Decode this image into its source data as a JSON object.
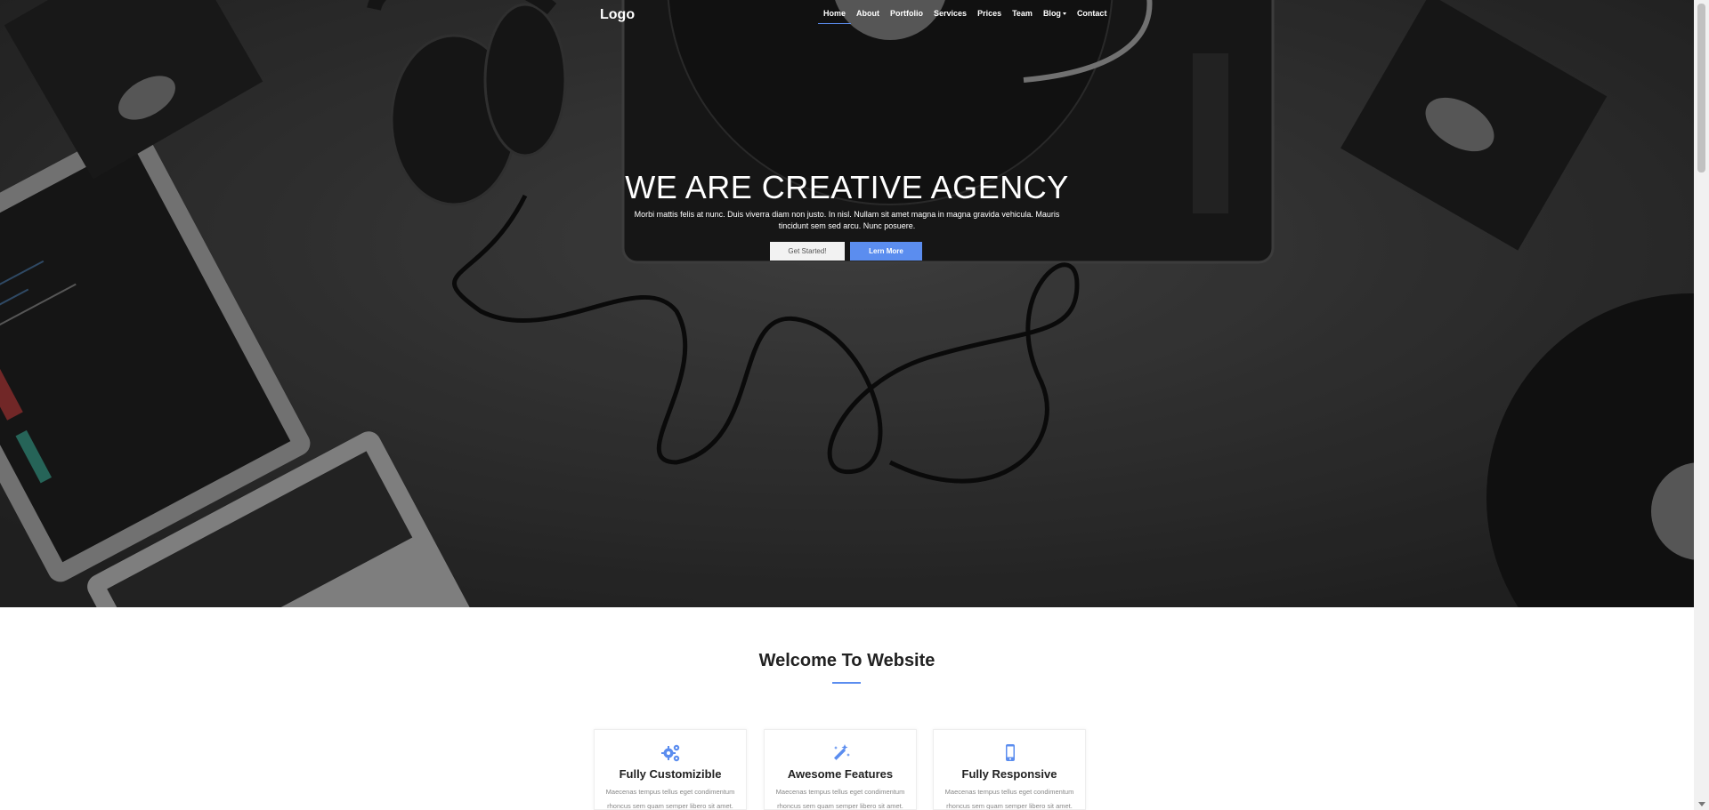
{
  "navbar": {
    "logo": "Logo",
    "items": [
      {
        "label": "Home",
        "active": true
      },
      {
        "label": "About"
      },
      {
        "label": "Portfolio"
      },
      {
        "label": "Services"
      },
      {
        "label": "Prices"
      },
      {
        "label": "Team"
      },
      {
        "label": "Blog",
        "dropdown": true
      },
      {
        "label": "Contact"
      }
    ]
  },
  "hero": {
    "title": "WE ARE CREATIVE AGENCY",
    "text": "Morbi mattis felis at nunc. Duis viverra diam non justo. In nisl. Nullam sit amet magna in magna gravida vehicula. Mauris tincidunt sem sed arcu. Nunc posuere.",
    "button_primary": "Get Started!",
    "button_secondary": "Lern More"
  },
  "welcome": {
    "title": "Welcome To Website"
  },
  "cards": [
    {
      "icon": "gears-icon",
      "title": "Fully Customizible",
      "text": "Maecenas tempus tellus eget condimentum rhoncus sem quam semper libero sit amet."
    },
    {
      "icon": "magic-wand-icon",
      "title": "Awesome Features",
      "text": "Maecenas tempus tellus eget condimentum rhoncus sem quam semper libero sit amet."
    },
    {
      "icon": "mobile-icon",
      "title": "Fully Responsive",
      "text": "Maecenas tempus tellus eget condimentum rhoncus sem quam semper libero sit amet."
    }
  ],
  "colors": {
    "accent": "#5b8def",
    "hero_bg": "#2b2b2b"
  }
}
